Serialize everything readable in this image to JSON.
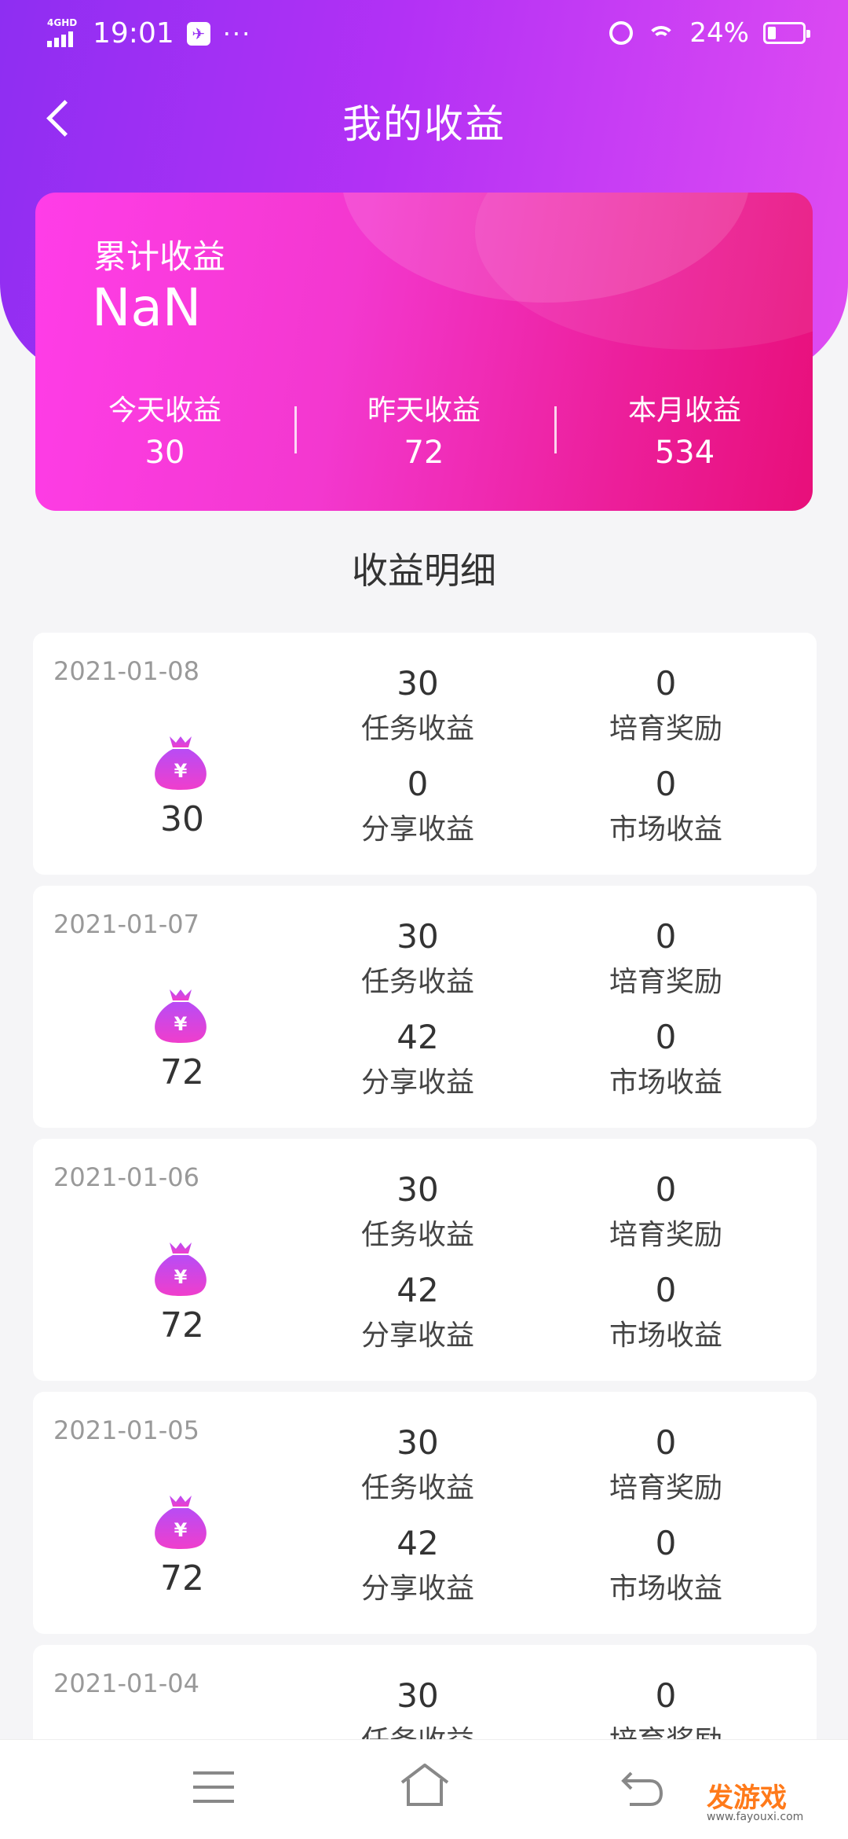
{
  "status_bar": {
    "network": "4GHD",
    "time": "19:01",
    "more": "···",
    "battery": "24%"
  },
  "header": {
    "title": "我的收益"
  },
  "summary": {
    "total_label": "累计收益",
    "total_value": "NaN",
    "stats": [
      {
        "label": "今天收益",
        "value": "30"
      },
      {
        "label": "昨天收益",
        "value": "72"
      },
      {
        "label": "本月收益",
        "value": "534"
      }
    ]
  },
  "detail": {
    "title": "收益明细",
    "labels": {
      "task": "任务收益",
      "nurture": "培育奖励",
      "share": "分享收益",
      "market": "市场收益"
    },
    "records": [
      {
        "date": "2021-01-08",
        "total": "30",
        "task": "30",
        "nurture": "0",
        "share": "0",
        "market": "0"
      },
      {
        "date": "2021-01-07",
        "total": "72",
        "task": "30",
        "nurture": "0",
        "share": "42",
        "market": "0"
      },
      {
        "date": "2021-01-06",
        "total": "72",
        "task": "30",
        "nurture": "0",
        "share": "42",
        "market": "0"
      },
      {
        "date": "2021-01-05",
        "total": "72",
        "task": "30",
        "nurture": "0",
        "share": "42",
        "market": "0"
      },
      {
        "date": "2021-01-04",
        "total": "",
        "task": "30",
        "nurture": "0",
        "share": "",
        "market": ""
      }
    ]
  },
  "watermark": {
    "text": "发游戏",
    "url": "www.fayouxi.com"
  },
  "colors": {
    "header": "#a531f4",
    "card_pink": "#f038c8",
    "bag_purple": "#c93df5"
  },
  "icons": [
    "back-icon",
    "money-bag-icon",
    "menu-icon",
    "home-icon",
    "return-icon"
  ]
}
